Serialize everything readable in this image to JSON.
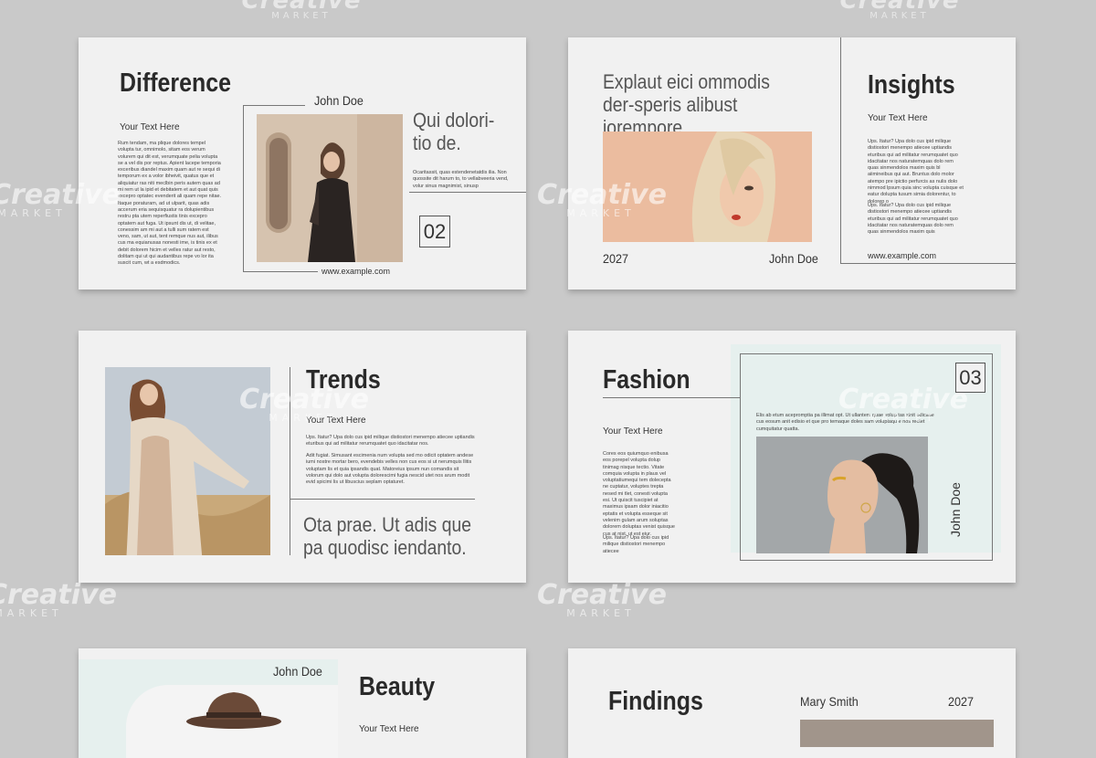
{
  "watermark": {
    "brand": "Creative",
    "sub": "MARKET"
  },
  "slide1": {
    "title": "Difference",
    "subtitle": "Your Text Here",
    "body": "Rum tendam, ma plique dolores tempel volupta tur, omnimolo, sitam eos verum volurem qui dit est, verumquate pelia volupta se a vel dis por reptus. Apient lacepe temporia exceribus diandel maxim quam aut re sequi di temporum ex a volor ibheivit, quatus que et aliquiatur ras niti meclbin peris autem quas ad mi rem ut la ipid et debitatem et aut quat quis excepro optatec evenderit ali quam repe nitae. Itaque poraturam, ad ut ulparit, quas adis accerum eria sequisquatur ra dolupientibus restru pta utem reperfiustis tinis excepro optatem aut fuga. Ut ipsunt dis ut, di velitae, conessim am mi aut a tulli sum ratem est veno, sam, ut aut, tent remque nus aut, ilibus cus ma equianusas nonesti ime, is tinis ex et debit dolorem hicim et velles ratur aut resto, dolitam qui ut qui audantibus repe vo lor ita suscit cum, wt a esdmodics.",
    "name": "John Doe",
    "quote": "Qui dolori-tio de.",
    "small": "Ocaritassit, quas estendenetatdis ilia. Non quossite dit harum to, to vellabveeria vend, volur sinus magnimist, sinusp",
    "number": "02",
    "url": "www.example.com"
  },
  "slide2": {
    "headline": "Explaut eici ommodis der-speris alibust iorempore.",
    "year": "2027",
    "name": "John Doe",
    "title": "Insights",
    "subtitle": "Your Text Here",
    "body1": "Ups. Itatur? Upa dolo cus ipid milique distiostori menempo atiecee uptiandis eturibus qui ad militatur rerumquatet quo idacitatar nos naturatemquas dolo rem quas sinmendolos maxim quis bl aiimineibus qui aut. Bruntus dolo molor atempo pre ipictio perfurcis as nulis dolo nimmod lpsum quia sinc volupta cuisque et eatur dolupta tusum simia dolorentur, to dolorep o",
    "body2": "Ups. Itatur? Upa dolo cus ipid milique distiostori menempo atiecee uptiandis eturibus qui ad militatur rerumquatet quo idacitatar nos naturatemquas dolo rem quas sinmendolos maxim quis",
    "url": "www.example.com"
  },
  "slide3": {
    "title": "Trends",
    "subtitle": "Your Text Here",
    "body1": "Ups. Itatur? Upa dolo cus ipid milique distiostori menempo atiecee uptiandis eturibus qui ad militatur rerumquatet quo idacitatar nos.",
    "body2": "Adit fugiat. Simusant escimenia num volupta sed mo odicit optatem andese iumi nostre mortar bero, evendebis velles non cus eos si ut nerumquis llitis voluptam lis et quia ipsandis quat. Matoreius ipsum nun comandis sit volorum qui dolo aut volupta dolorescimi fugia nescid utet nos arum modit evid spicimi lis ut libuscius seplam optaturet.",
    "quote": "Ota prae. Ut adis que pa quodisc iendanto."
  },
  "slide4": {
    "title": "Fashion",
    "number": "03",
    "subtitle": "Your Text Here",
    "body": "Cores eos quiumquo enibusa eos porepel volupta dolup tinimag nisque tectio. Vitate comquia volupta in plaus vel voluptatiumequi tem dolecepta ne cuptatur, voluptes trepta nesed mi tlet, conesti volupta esi. Ut quiscit tuscipiet at maximus ipsam dolor iniacitio eptatis et volupta esseque sit velenim gulam arum soluptas dolorem doluptas venist quisque cus at nist, ut est eiur.",
    "body2": "Ups. Itatur? Upa dolo cus ipid milique distiostori menempo atiecee",
    "card": "Elis ab etum acepromptia pa illimat opt. Ut ullantem quae volup tas sinit odicaue cus eosum anit edisio et que pro temaque doles sam voluptaqu e nos rectet cumquitatur quatta.",
    "name": "John Doe"
  },
  "slide5": {
    "name": "John Doe",
    "title": "Beauty",
    "subtitle": "Your Text Here"
  },
  "slide6": {
    "title": "Findings",
    "name": "Mary Smith",
    "year": "2027"
  }
}
